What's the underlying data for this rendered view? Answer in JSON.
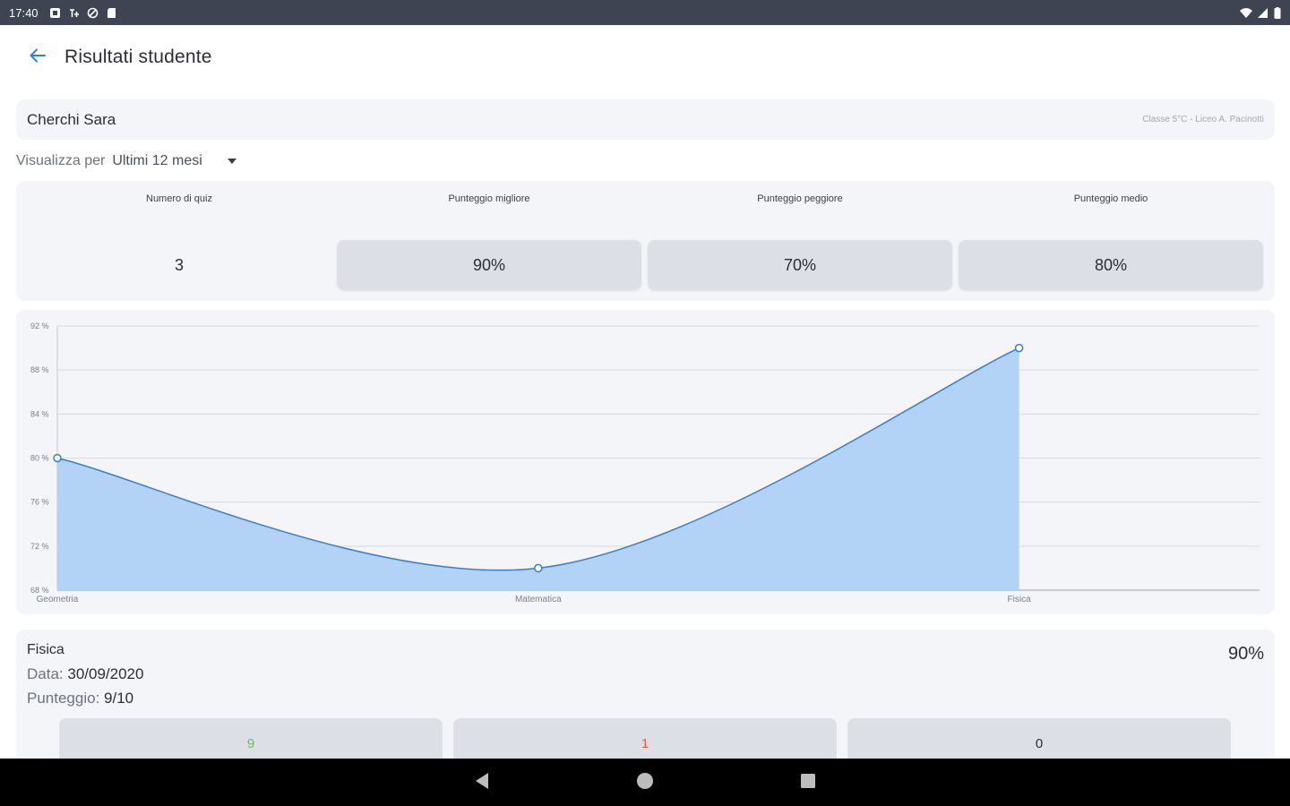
{
  "status_bar": {
    "time": "17:40",
    "left_icons": [
      "app-icon",
      "network-icon",
      "sync-icon",
      "sd-card-icon"
    ],
    "right_icons": [
      "wifi-icon",
      "signal-icon",
      "battery-icon"
    ]
  },
  "header": {
    "title": "Risultati studente"
  },
  "student": {
    "name": "Cherchi Sara",
    "class_info": "Classe 5°C - Liceo A. Pacinotti"
  },
  "filter": {
    "label": "Visualizza per",
    "value": "Ultimi 12 mesi"
  },
  "stats": [
    {
      "label": "Numero di quiz",
      "value": "3",
      "boxed": false
    },
    {
      "label": "Punteggio migliore",
      "value": "90%",
      "boxed": true
    },
    {
      "label": "Punteggio peggiore",
      "value": "70%",
      "boxed": true
    },
    {
      "label": "Punteggio medio",
      "value": "80%",
      "boxed": true
    }
  ],
  "chart_data": {
    "type": "area",
    "categories": [
      "Geometria",
      "Matematica",
      "Fisica"
    ],
    "values": [
      80,
      70,
      90
    ],
    "ylim": [
      68,
      92
    ],
    "yticks": [
      "68 %",
      "72 %",
      "76 %",
      "80 %",
      "84 %",
      "88 %",
      "92 %"
    ],
    "grid": true,
    "colors": {
      "line": "#2f7fe0",
      "fill": "#abcff5"
    }
  },
  "quiz": {
    "subject": "Fisica",
    "score": "90%",
    "date_label": "Data:",
    "date_value": "30/09/2020",
    "points_label": "Punteggio:",
    "points_value": "9/10",
    "answers": [
      {
        "value": "9",
        "color": "#6cc04a"
      },
      {
        "value": "1",
        "color": "#e85a4f"
      },
      {
        "value": "0",
        "color": "#2b2e35"
      }
    ]
  },
  "colors": {
    "accent": "#2f7fe0",
    "card": "#f3f5f8",
    "status_bar": "#3f4453"
  }
}
